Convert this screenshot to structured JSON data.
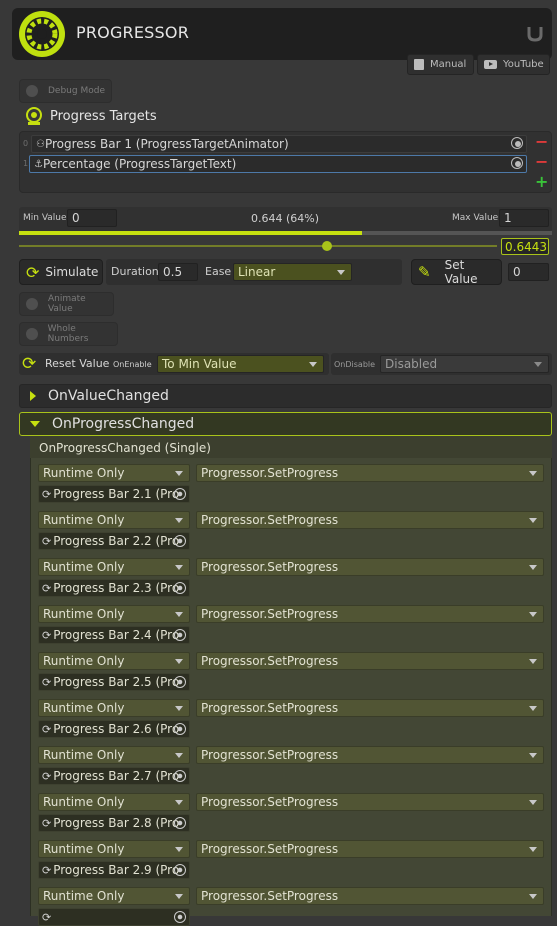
{
  "app": {
    "title": "PROGRESSOR"
  },
  "toolbar": {
    "manual_label": "Manual",
    "youtube_label": "YouTube"
  },
  "debug_mode": {
    "label": "Debug Mode"
  },
  "progress_targets": {
    "title": "Progress Targets",
    "items": [
      {
        "index": "0",
        "label": "Progress Bar 1 (ProgressTargetAnimator)"
      },
      {
        "index": "1",
        "label": "Percentage (ProgressTargetText)"
      }
    ]
  },
  "range": {
    "min_label": "Min Value",
    "min_value": "0",
    "center_value": "0.644 (64%)",
    "max_label": "Max Value",
    "max_value": "1",
    "slider_value": "0.6443",
    "progress": 0.644
  },
  "simulate": {
    "button_label": "Simulate",
    "duration_label": "Duration",
    "duration_value": "0.5",
    "ease_label": "Ease",
    "ease_value": "Linear",
    "set_value_label": "Set Value",
    "set_value_input": "0"
  },
  "options": {
    "animate_value": "Animate Value",
    "whole_numbers": "Whole Numbers"
  },
  "reset": {
    "label": "Reset Value",
    "on_enable_label": "OnEnable",
    "on_enable_value": "To Min Value",
    "on_disable_label": "OnDisable",
    "on_disable_value": "Disabled"
  },
  "events": {
    "on_value_changed": "OnValueChanged",
    "on_progress_changed": "OnProgressChanged",
    "signature": "OnProgressChanged (Single)",
    "listeners": [
      {
        "mode": "Runtime Only",
        "target": "Progress Bar 2.1 (Pro",
        "method": "Progressor.SetProgress"
      },
      {
        "mode": "Runtime Only",
        "target": "Progress Bar 2.2 (Pro",
        "method": "Progressor.SetProgress"
      },
      {
        "mode": "Runtime Only",
        "target": "Progress Bar 2.3 (Pro",
        "method": "Progressor.SetProgress"
      },
      {
        "mode": "Runtime Only",
        "target": "Progress Bar 2.4 (Pro",
        "method": "Progressor.SetProgress"
      },
      {
        "mode": "Runtime Only",
        "target": "Progress Bar 2.5 (Pro",
        "method": "Progressor.SetProgress"
      },
      {
        "mode": "Runtime Only",
        "target": "Progress Bar 2.6 (Pro",
        "method": "Progressor.SetProgress"
      },
      {
        "mode": "Runtime Only",
        "target": "Progress Bar 2.7 (Pro",
        "method": "Progressor.SetProgress"
      },
      {
        "mode": "Runtime Only",
        "target": "Progress Bar 2.8 (Pro",
        "method": "Progressor.SetProgress"
      },
      {
        "mode": "Runtime Only",
        "target": "Progress Bar 2.9 (Pro",
        "method": "Progressor.SetProgress"
      },
      {
        "mode": "Runtime Only",
        "target": "",
        "method": "Progressor.SetProgress"
      }
    ]
  },
  "colors": {
    "accent": "#c6e010",
    "accent_dark": "#6e7d12",
    "event_bg": "#434735",
    "remove": "#e03a3a",
    "add": "#39c339"
  }
}
